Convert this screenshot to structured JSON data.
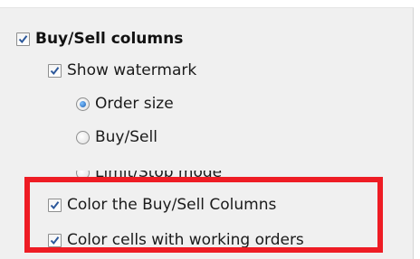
{
  "options": {
    "buy_sell_columns": {
      "label": "Buy/Sell columns",
      "checked": true
    },
    "show_watermark": {
      "label": "Show watermark",
      "checked": true
    },
    "watermark_modes": [
      {
        "label": "Order size",
        "selected": true
      },
      {
        "label": "Buy/Sell",
        "selected": false
      },
      {
        "label": "Limit/Stop mode",
        "selected": false
      }
    ],
    "color_buy_sell_columns": {
      "label": "Color the Buy/Sell Columns",
      "checked": true
    },
    "color_cells_working_orders": {
      "label": "Color cells with working orders",
      "checked": true
    }
  },
  "colors": {
    "highlight_border": "#ee1c24",
    "check_mark": "#2b579a",
    "radio_selected": "#1d5fb3"
  },
  "icons": {
    "checkbox_checked": "check-icon",
    "radio_selected": "radio-dot-icon"
  }
}
